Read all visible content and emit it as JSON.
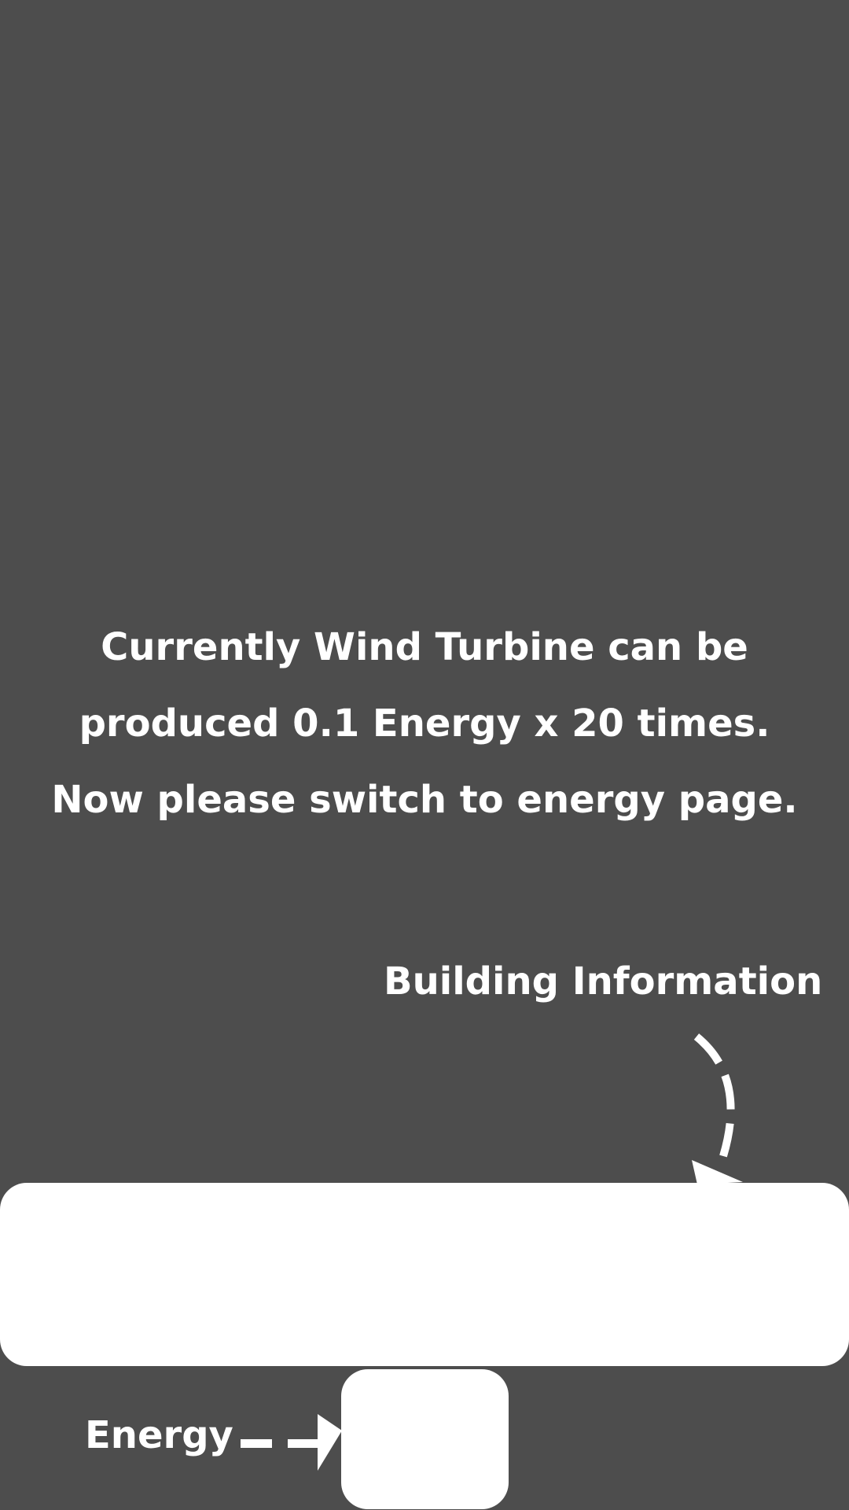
{
  "tutorial": {
    "lines": [
      "Currently Wind Turbine can be",
      "produced 0.1 Energy x 20 times.",
      "Now please switch to energy page."
    ]
  },
  "labels": {
    "building_information": "Building Information",
    "energy": "Energy"
  },
  "colors": {
    "overlay": "#4d4d4d",
    "highlight": "#ffffff",
    "text": "#ffffff"
  },
  "icons": {
    "building_arrow": "curved-dashed-arrow-icon",
    "energy_arrow": "dashed-arrow-right-icon"
  }
}
